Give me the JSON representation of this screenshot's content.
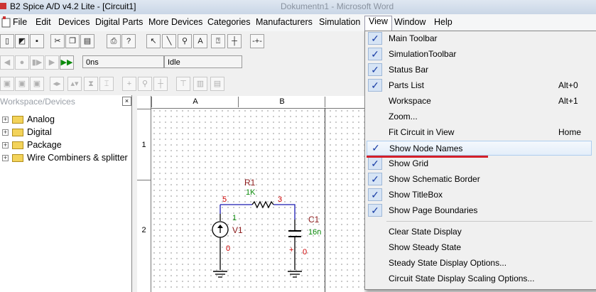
{
  "window": {
    "title": "B2 Spice A/D v4.2 Lite - [Circuit1]",
    "blurred_title": "Dokumentn1 - Microsoft Word"
  },
  "menubar": {
    "items": [
      {
        "label": "File"
      },
      {
        "label": "Edit"
      },
      {
        "label": "Devices"
      },
      {
        "label": "Digital Parts"
      },
      {
        "label": "More Devices"
      },
      {
        "label": "Categories"
      },
      {
        "label": "Manufacturers"
      },
      {
        "label": "Simulation"
      },
      {
        "label": "View"
      },
      {
        "label": "Window"
      },
      {
        "label": "Help"
      }
    ],
    "active": "View"
  },
  "sim_toolbar": {
    "time": "0ns",
    "status": "Idle"
  },
  "workspace": {
    "title": "Workspace/Devices",
    "tree": [
      {
        "label": "Analog"
      },
      {
        "label": "Digital"
      },
      {
        "label": "Package"
      },
      {
        "label": "Wire Combiners & splitter"
      }
    ]
  },
  "schematic": {
    "columns": [
      "A",
      "B"
    ],
    "rows": [
      "1",
      "2"
    ],
    "components": {
      "r1": {
        "name": "R1",
        "value": "1K"
      },
      "c1": {
        "name": "C1",
        "value": "16n"
      },
      "v1": {
        "name": "V1"
      }
    },
    "nodes": {
      "n5": "5",
      "n3": "3",
      "n1": "1",
      "n0a": "0",
      "n0b": "0"
    }
  },
  "view_menu": {
    "items": [
      {
        "label": "Main Toolbar",
        "checked": true
      },
      {
        "label": "SimulationToolbar",
        "checked": true
      },
      {
        "label": "Status Bar",
        "checked": true
      },
      {
        "label": "Parts List",
        "checked": true,
        "shortcut": "Alt+0"
      },
      {
        "label": "Workspace",
        "checked": false,
        "shortcut": "Alt+1"
      },
      {
        "label": "Zoom...",
        "checked": false
      },
      {
        "label": "Fit Circuit in View",
        "checked": false,
        "shortcut": "Home"
      },
      {
        "label": "Show Node Names",
        "checked": true,
        "highlighted": true
      },
      {
        "label": "Show Grid",
        "checked": true
      },
      {
        "label": "Show Schematic Border",
        "checked": true
      },
      {
        "label": "Show TitleBox",
        "checked": true
      },
      {
        "label": "Show Page Boundaries",
        "checked": true
      },
      {
        "label": "Clear State Display",
        "checked": false
      },
      {
        "label": "Show Steady State",
        "checked": false
      },
      {
        "label": "Steady State Display Options...",
        "checked": false
      },
      {
        "label": "Circuit State Display Scaling Options...",
        "checked": false
      }
    ]
  },
  "colors": {
    "accent": "#d3202a",
    "check": "#1a3ea6",
    "wire": "#1a1ab0",
    "node_red": "#cc0000",
    "value_green": "#0a8a0a"
  }
}
